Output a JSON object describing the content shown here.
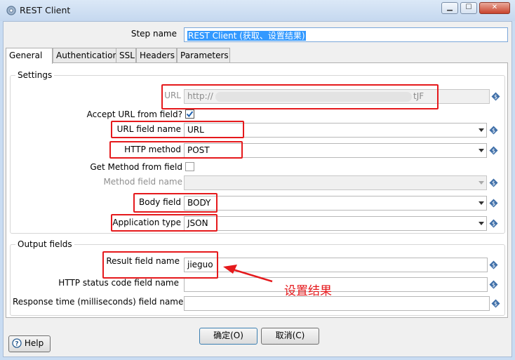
{
  "window": {
    "title": "REST Client",
    "minimize": "▁",
    "maximize": "☐",
    "close": "✕"
  },
  "step_name": {
    "label": "Step name",
    "value": "REST Client (获取、设置结果)"
  },
  "tabs": [
    "General",
    "Authentication",
    "SSL",
    "Headers",
    "Parameters"
  ],
  "settings": {
    "group_title": "Settings",
    "url": {
      "label": "URL",
      "value": "http://",
      "value_end": "tJF"
    },
    "accept_url_from_field": {
      "label": "Accept URL from field?",
      "checked": true
    },
    "url_field_name": {
      "label": "URL field name",
      "value": "URL"
    },
    "http_method": {
      "label": "HTTP method",
      "value": "POST"
    },
    "get_method_from_field": {
      "label": "Get Method from field",
      "checked": false
    },
    "method_field_name": {
      "label": "Method field name",
      "value": ""
    },
    "body_field": {
      "label": "Body field",
      "value": "BODY"
    },
    "application_type": {
      "label": "Application type",
      "value": "JSON"
    }
  },
  "output_fields": {
    "group_title": "Output fields",
    "result_field_name": {
      "label": "Result field name",
      "value": "jieguo"
    },
    "http_status_code_field_name": {
      "label": "HTTP status code field name",
      "value": ""
    },
    "response_time_field_name": {
      "label": "Response time (milliseconds) field name",
      "value": ""
    }
  },
  "annotation": {
    "text": "设置结果",
    "color": "#e5191c"
  },
  "buttons": {
    "ok": "确定(O)",
    "cancel": "取消(C)",
    "help": "Help"
  }
}
